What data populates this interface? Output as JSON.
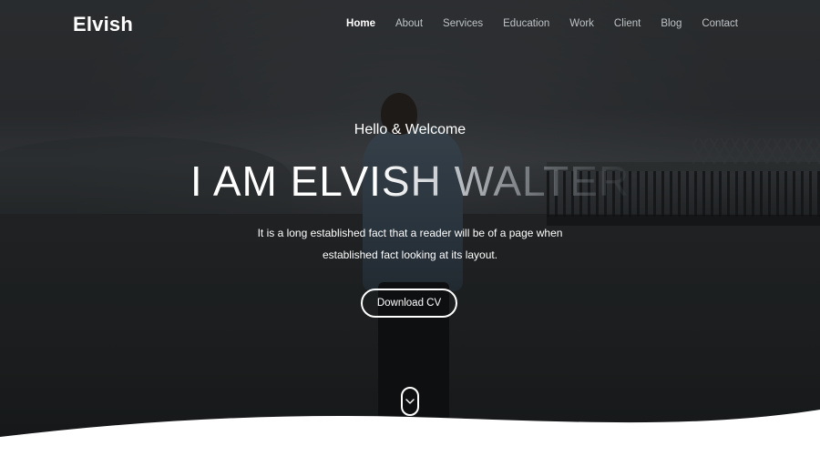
{
  "brand": {
    "logo": "Elvish"
  },
  "nav": {
    "items": [
      {
        "label": "Home",
        "active": true
      },
      {
        "label": "About"
      },
      {
        "label": "Services"
      },
      {
        "label": "Education"
      },
      {
        "label": "Work"
      },
      {
        "label": "Client"
      },
      {
        "label": "Blog"
      },
      {
        "label": "Contact"
      }
    ]
  },
  "hero": {
    "greeting": "Hello & Welcome",
    "headline": "I AM ELVISH WALTER",
    "description_line1": "It is a long established fact that a reader will be of a page when",
    "description_line2": "established fact looking at its layout.",
    "cta_label": "Download CV",
    "scroll_icon": "chevron-down-icon"
  },
  "colors": {
    "text": "#ffffff",
    "nav_inactive": "#bfc3c6",
    "wave": "#ffffff"
  }
}
